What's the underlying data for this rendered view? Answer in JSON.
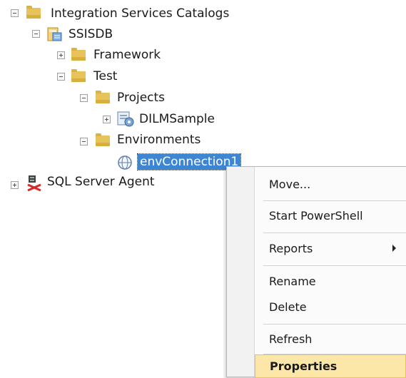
{
  "tree": {
    "catalogs": "Integration Services Catalogs",
    "ssisdb": "SSISDB",
    "framework": "Framework",
    "test": "Test",
    "projects": "Projects",
    "project": "DILMSample",
    "environments": "Environments",
    "environment": "envConnection1",
    "agent": "SQL Server Agent"
  },
  "context_menu": {
    "items": [
      {
        "label": "Move..."
      },
      {
        "label": "Start PowerShell"
      },
      {
        "label": "Reports"
      },
      {
        "label": "Rename"
      },
      {
        "label": "Delete"
      },
      {
        "label": "Refresh"
      },
      {
        "label": "Properties"
      }
    ]
  },
  "colors": {
    "folder": "#e7c35c",
    "selection": "#3d86d4",
    "menu_highlight": "#fce7a8"
  }
}
